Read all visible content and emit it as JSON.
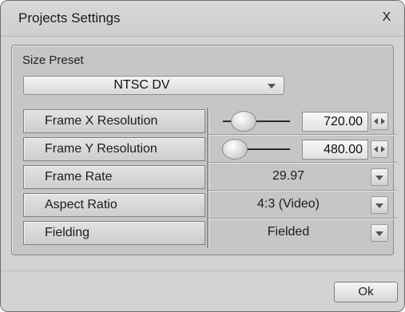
{
  "window": {
    "title": "Projects Settings",
    "close_label": "X"
  },
  "size_preset": {
    "label": "Size Preset",
    "selected": "NTSC DV"
  },
  "settings": {
    "frame_x": {
      "label": "Frame X Resolution",
      "value": "720.00",
      "slider_fraction": 0.31
    },
    "frame_y": {
      "label": "Frame Y Resolution",
      "value": "480.00",
      "slider_fraction": 0.18
    },
    "frame_rate": {
      "label": "Frame Rate",
      "value": "29.97"
    },
    "aspect_ratio": {
      "label": "Aspect Ratio",
      "value": "4:3 (Video)"
    },
    "fielding": {
      "label": "Fielding",
      "value": "Fielded"
    }
  },
  "footer": {
    "ok_label": "Ok"
  }
}
